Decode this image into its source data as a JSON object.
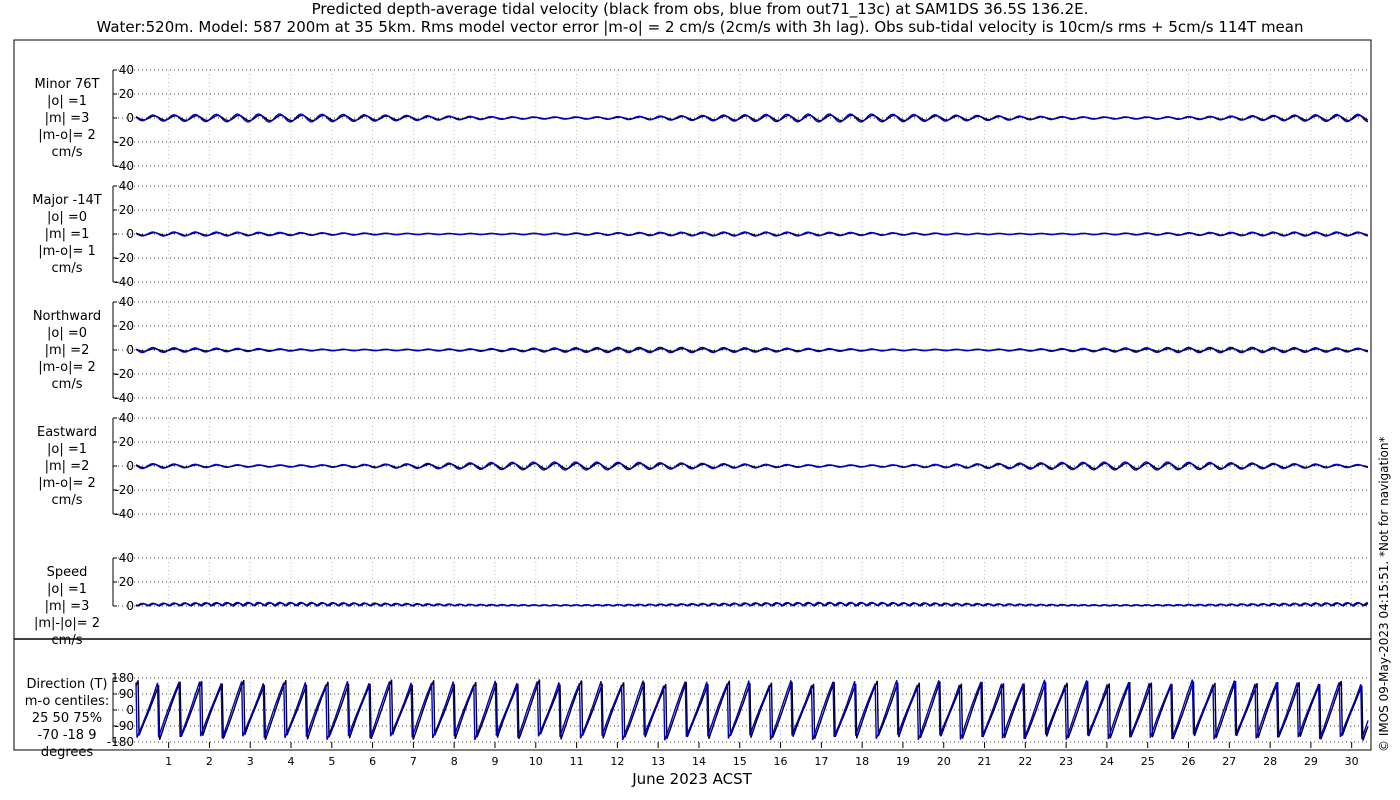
{
  "title_line1": "Predicted depth-average tidal velocity (black from obs, blue from out71_13c) at SAM1DS 36.5S 136.2E.",
  "title_line2": "Water:520m. Model: 587 200m at 35 5km. Rms model vector error |m-o| = 2 cm/s (2cm/s with 3h lag). Obs sub-tidal velocity is 10cm/s rms + 5cm/s 114T mean",
  "footer": "© IMOS 09-May-2023 04:15:51. *Not for navigation*",
  "colors": {
    "obs": "#000000",
    "model": "#0000cc",
    "grid": "#999999"
  },
  "chart_data": [
    {
      "type": "line",
      "label": [
        "Minor 76T",
        "|o| =1",
        "|m| =3",
        "|m-o|= 2",
        "cm/s"
      ],
      "ylim": [
        -40,
        40
      ],
      "yticks": [
        "40",
        "20",
        "0",
        "-20",
        "-40"
      ],
      "yvals": [
        40,
        20,
        0,
        -20,
        -40
      ],
      "series": [
        {
          "amplitude": 2.0,
          "color": "obs"
        },
        {
          "amplitude": 3.0,
          "color": "model"
        }
      ]
    },
    {
      "type": "line",
      "label": [
        "Major -14T",
        "|o| =0",
        "|m| =1",
        "|m-o|= 1",
        "cm/s"
      ],
      "ylim": [
        -40,
        40
      ],
      "yticks": [
        "40",
        "20",
        "0",
        "-20",
        "-40"
      ],
      "yvals": [
        40,
        20,
        0,
        -20,
        -40
      ],
      "series": [
        {
          "amplitude": 1.0,
          "color": "obs"
        },
        {
          "amplitude": 1.5,
          "color": "model"
        }
      ]
    },
    {
      "type": "line",
      "label": [
        "Northward",
        "|o| =0",
        "|m| =2",
        "|m-o|= 2",
        "cm/s"
      ],
      "ylim": [
        -40,
        40
      ],
      "yticks": [
        "40",
        "20",
        "0",
        "-20",
        "-40"
      ],
      "yvals": [
        40,
        20,
        0,
        -20,
        -40
      ],
      "series": [
        {
          "amplitude": 1.0,
          "color": "obs"
        },
        {
          "amplitude": 2.0,
          "color": "model"
        }
      ]
    },
    {
      "type": "line",
      "label": [
        "Eastward",
        "|o| =1",
        "|m| =2",
        "|m-o|= 2",
        "cm/s"
      ],
      "ylim": [
        -40,
        40
      ],
      "yticks": [
        "40",
        "20",
        "0",
        "-20",
        "-40"
      ],
      "yvals": [
        40,
        20,
        0,
        -20,
        -40
      ],
      "series": [
        {
          "amplitude": 2.0,
          "color": "obs"
        },
        {
          "amplitude": 3.0,
          "color": "model"
        }
      ]
    },
    {
      "type": "line",
      "label": [
        "Speed",
        "|o| =1",
        "|m| =3",
        "|m|-|o|= 2",
        "cm/s"
      ],
      "ylim": [
        0,
        40
      ],
      "yticks": [
        "40",
        "20",
        "0"
      ],
      "yvals": [
        40,
        20,
        0
      ],
      "series": [
        {
          "amplitude": 2.0,
          "color": "obs"
        },
        {
          "amplitude": 2.5,
          "color": "model"
        }
      ]
    },
    {
      "type": "line",
      "label": [
        "Direction (T)",
        "m-o centiles:",
        "25  50  75%",
        "-70 -18   9",
        "degrees"
      ],
      "ylim": [
        -180,
        180
      ],
      "yticks": [
        "180",
        "90",
        "0",
        "-90",
        "-180"
      ],
      "yvals": [
        180,
        90,
        0,
        -90,
        -180
      ],
      "series": [
        {
          "color": "obs"
        },
        {
          "color": "model"
        }
      ]
    }
  ],
  "x_axis": {
    "label": "June 2023 ACST",
    "ticks": [
      "1",
      "2",
      "3",
      "4",
      "5",
      "6",
      "7",
      "8",
      "9",
      "10",
      "11",
      "12",
      "13",
      "14",
      "15",
      "16",
      "17",
      "18",
      "19",
      "20",
      "21",
      "22",
      "23",
      "24",
      "25",
      "26",
      "27",
      "28",
      "29",
      "30"
    ],
    "range_days": [
      0.2,
      30.4
    ]
  }
}
